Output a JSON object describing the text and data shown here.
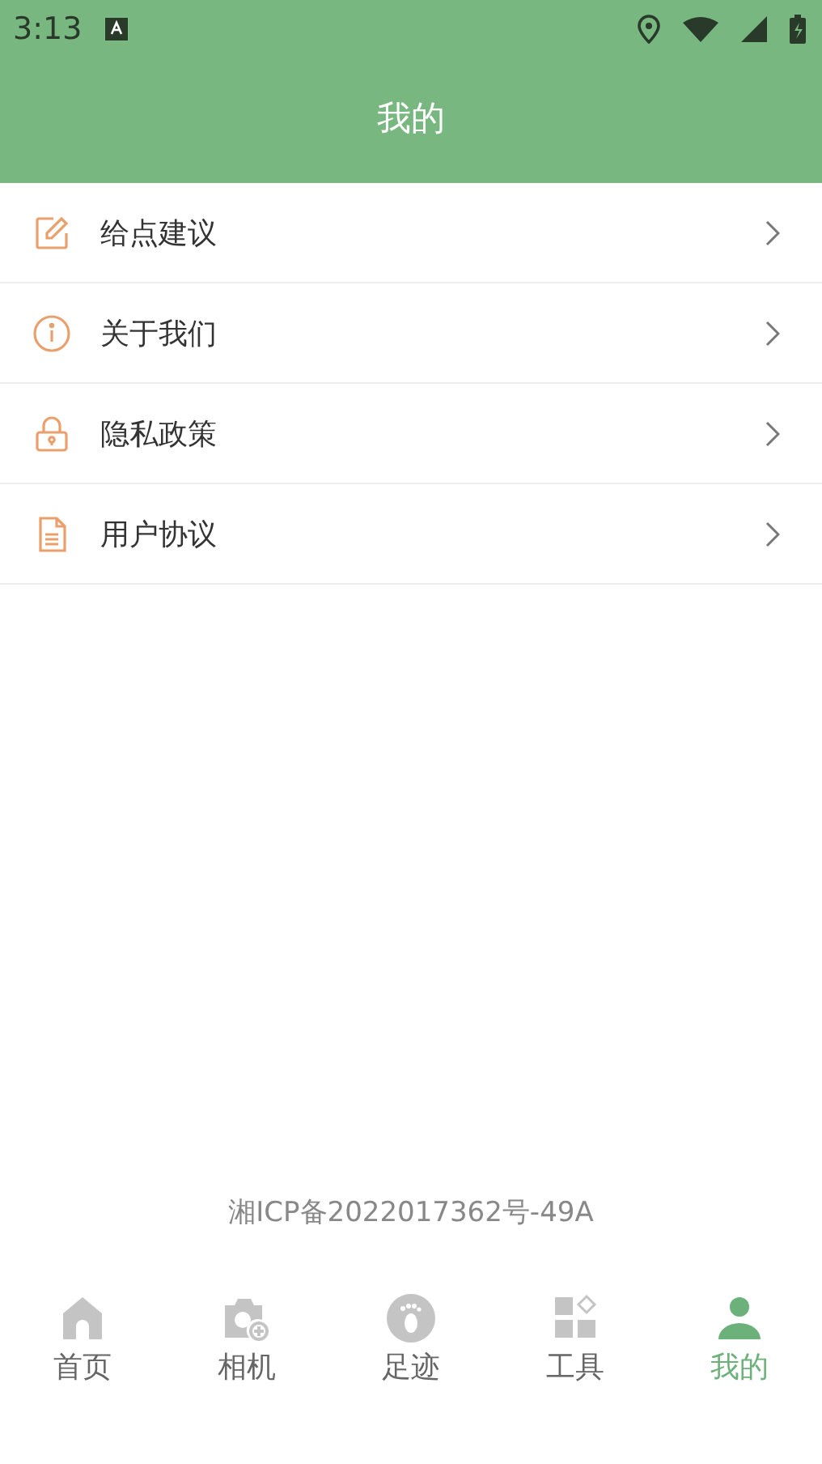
{
  "status_bar": {
    "time": "3:13"
  },
  "header": {
    "title": "我的"
  },
  "menu": [
    {
      "kind": "feedback",
      "label": "给点建议"
    },
    {
      "kind": "about",
      "label": "关于我们"
    },
    {
      "kind": "privacy",
      "label": "隐私政策"
    },
    {
      "kind": "agreement",
      "label": "用户协议"
    }
  ],
  "footer": {
    "text": "湘ICP备2022017362号-49A"
  },
  "tabs": [
    {
      "kind": "home",
      "label": "首页",
      "selected": false
    },
    {
      "kind": "camera",
      "label": "相机",
      "selected": false
    },
    {
      "kind": "footprint",
      "label": "足迹",
      "selected": false
    },
    {
      "kind": "tools",
      "label": "工具",
      "selected": false
    },
    {
      "kind": "profile",
      "label": "我的",
      "selected": true
    }
  ]
}
